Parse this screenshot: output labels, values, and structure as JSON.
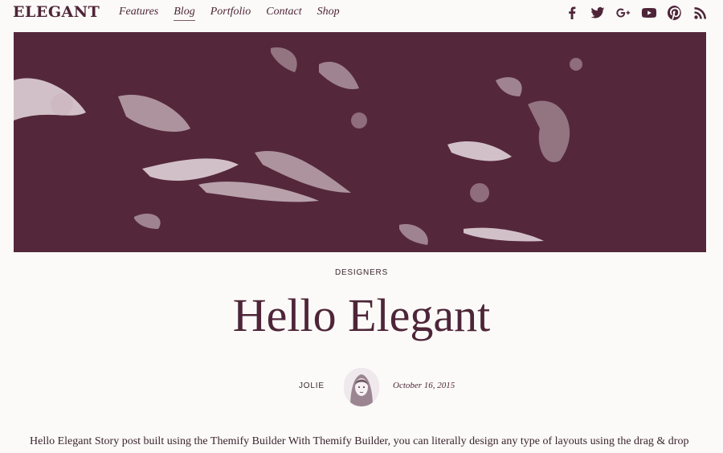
{
  "header": {
    "logo": "ELEGANT",
    "nav": [
      {
        "label": "Features"
      },
      {
        "label": "Blog",
        "active": true
      },
      {
        "label": "Portfolio"
      },
      {
        "label": "Contact"
      },
      {
        "label": "Shop"
      }
    ],
    "social_icons": [
      "facebook-icon",
      "twitter-icon",
      "google-plus-icon",
      "youtube-icon",
      "pinterest-icon",
      "rss-icon"
    ]
  },
  "colors": {
    "brand": "#4e2538",
    "hero_background": "#54283a",
    "page_background": "#fbfaf8"
  },
  "post": {
    "category": "DESIGNERS",
    "title": "Hello Elegant",
    "author": "JOLIE",
    "date": "October 16, 2015",
    "excerpt": "Hello Elegant Story post built using the Themify Builder With Themify Builder, you can literally design any type of layouts using the drag & drop"
  }
}
